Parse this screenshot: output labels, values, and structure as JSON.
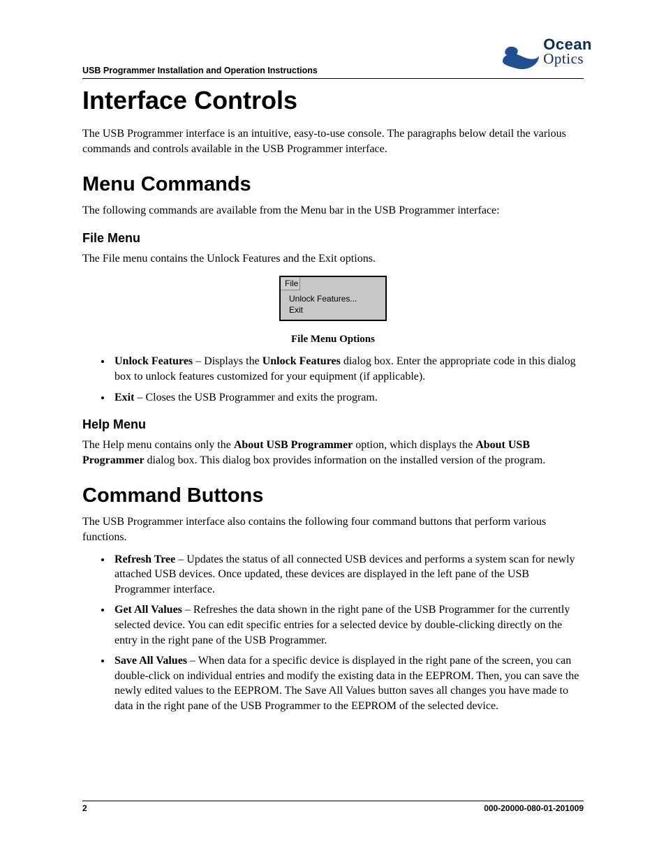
{
  "header": {
    "running_title": "USB Programmer Installation and Operation Instructions",
    "brand_top": "Ocean",
    "brand_bottom": "Optics"
  },
  "h1": "Interface Controls",
  "intro": "The USB Programmer interface is an intuitive, easy-to-use console.  The paragraphs below detail the various commands and controls available in the USB Programmer interface.",
  "menu_commands": {
    "title": "Menu Commands",
    "intro": "The following commands are available from the Menu bar in the USB Programmer interface:",
    "file": {
      "title": "File Menu",
      "intro": "The File menu contains the Unlock Features and the Exit options.",
      "figure": {
        "menu_label": "File",
        "items": [
          "Unlock Features...",
          "Exit"
        ]
      },
      "caption": "File Menu Options",
      "bullets": [
        {
          "bold1": "Unlock Features",
          "mid1": "  – Displays the ",
          "bold2": "Unlock Features",
          "mid2": " dialog box. Enter the appropriate code in this dialog box to unlock features customized for your equipment (if applicable)."
        },
        {
          "bold1": "Exit",
          "mid1": " – Closes the USB Programmer and exits the program."
        }
      ]
    },
    "help": {
      "title": "Help Menu",
      "p_pre": "The Help menu contains only the ",
      "p_b1": "About USB Programmer",
      "p_mid": " option, which displays the ",
      "p_b2": "About USB Programmer",
      "p_post": " dialog box. This dialog box provides information on the installed version of the program."
    }
  },
  "command_buttons": {
    "title": "Command Buttons",
    "intro": "The USB Programmer interface also contains the following four command buttons that perform various functions.",
    "bullets": [
      {
        "bold": "Refresh Tree",
        "text": " – Updates the status of all connected USB devices and performs a system scan for newly attached USB devices. Once updated, these devices are displayed in the left pane of the USB Programmer interface."
      },
      {
        "bold": "Get All Values",
        "text": " – Refreshes the data shown in the right pane of the USB Programmer for the currently selected device. You can edit specific entries for a selected device by double-clicking directly on the entry in the right pane of the USB Programmer."
      },
      {
        "bold": "Save All Values",
        "text": " – When data for a specific device is displayed in the right pane of the screen, you can double-click on individual entries and modify the existing data in the EEPROM. Then, you can save the newly edited values to the EEPROM. The Save All Values button saves all changes you have made to data in the right pane of the USB Programmer to the EEPROM of the selected device."
      }
    ]
  },
  "footer": {
    "page": "2",
    "docnum": "000-20000-080-01-201009"
  }
}
